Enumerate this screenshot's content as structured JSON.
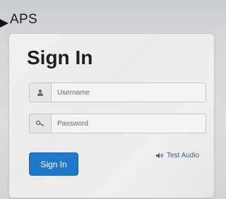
{
  "app": {
    "title": "APS"
  },
  "form": {
    "heading": "Sign In",
    "username": {
      "placeholder": "Username",
      "value": "",
      "icon": "user-icon"
    },
    "password": {
      "placeholder": "Password",
      "value": "",
      "icon": "key-icon"
    },
    "submit_label": "Sign In",
    "test_audio_label": "Test Audio",
    "test_audio_icon": "speaker-icon"
  },
  "colors": {
    "primary_button": "#1f78c9",
    "link": "#3d5e86"
  }
}
